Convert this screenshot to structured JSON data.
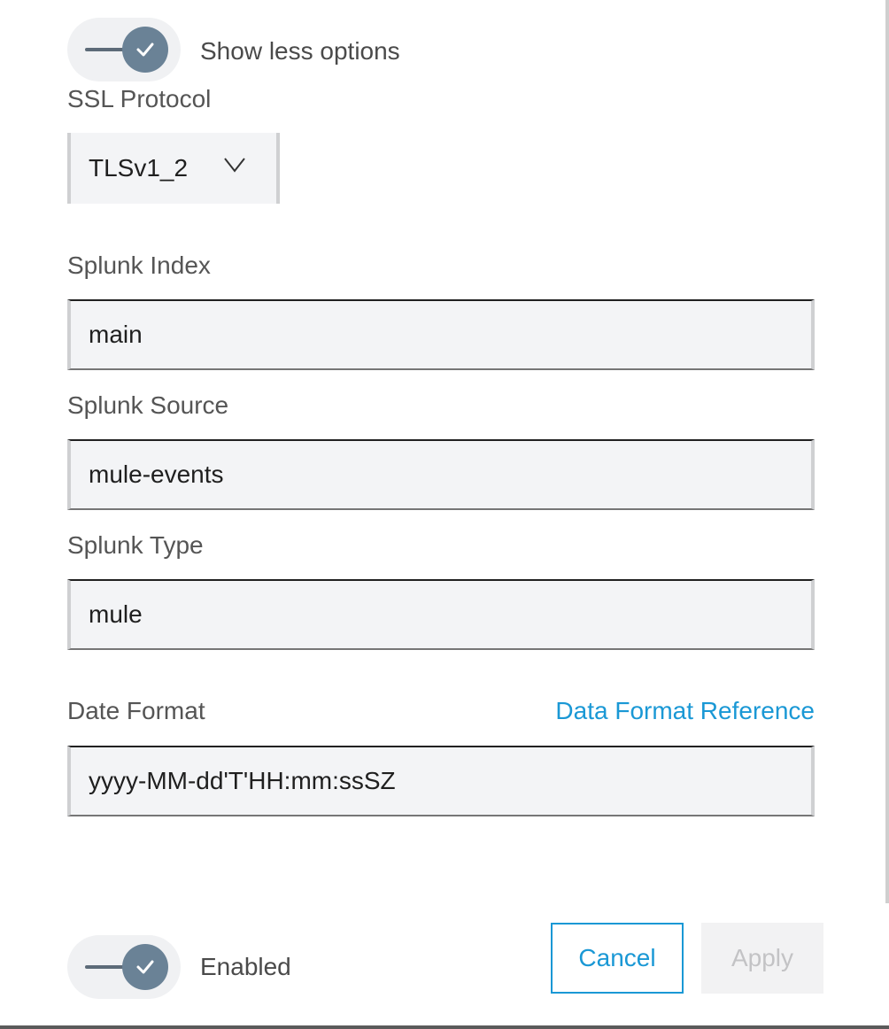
{
  "advanced_toggle": {
    "label": "Show less options",
    "checked": true,
    "icon": "check-icon"
  },
  "ssl_protocol": {
    "label": "SSL Protocol",
    "selected": "TLSv1_2",
    "icon": "chevron-down-icon"
  },
  "splunk_index": {
    "label": "Splunk Index",
    "value": "main"
  },
  "splunk_source": {
    "label": "Splunk Source",
    "value": "mule-events"
  },
  "splunk_type": {
    "label": "Splunk Type",
    "value": "mule"
  },
  "date_format": {
    "label": "Date Format",
    "value": "yyyy-MM-dd'T'HH:mm:ssSZ",
    "reference_link": "Data Format Reference"
  },
  "enabled_toggle": {
    "label": "Enabled",
    "checked": true,
    "icon": "check-icon"
  },
  "actions": {
    "cancel_label": "Cancel",
    "apply_label": "Apply"
  },
  "colors": {
    "accent": "#1a98d5",
    "toggle_knob": "#6a8296",
    "field_background": "#f3f4f6"
  }
}
